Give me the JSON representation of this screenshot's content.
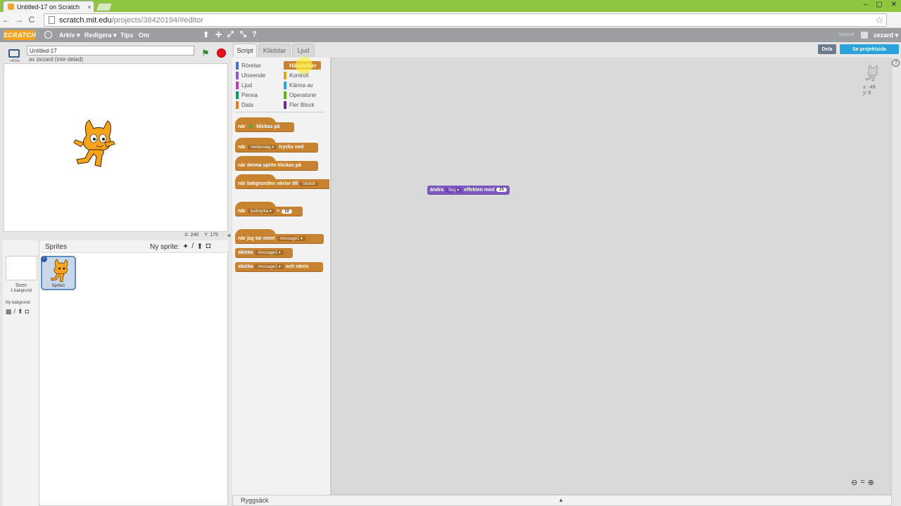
{
  "browser": {
    "tab_title": "Untitled-17 on Scratch",
    "tab_close": "×",
    "url_domain": "scratch.mit.edu",
    "url_path": "/projects/38420194/#editor",
    "window_controls": [
      "–",
      "▢",
      "✕"
    ],
    "nav": {
      "back": "←",
      "forward": "→",
      "reload": "C"
    },
    "star": "☆"
  },
  "menubar": {
    "logo": "SCRATCH",
    "items": [
      "Arkiv ▾",
      "Redigera ▾",
      "Tips",
      "Om"
    ],
    "tool_icons": [
      "⬆",
      "✛",
      "⤢",
      "⤡",
      "?"
    ],
    "saved": "Sparad",
    "user": "zezard ▾"
  },
  "stage": {
    "version": "v429a",
    "title_value": "Untitled-17",
    "byline": "av zezard (inte delad)",
    "coords_x": "X: 240",
    "coords_y": "Y: 175",
    "collapse": "◀",
    "green_flag": "⚑"
  },
  "tabs": [
    "Script",
    "Klädslar",
    "Ljud"
  ],
  "share_button": "Dela",
  "project_page_button": "Se projektsida",
  "categories": {
    "left": [
      {
        "label": "Rörelse",
        "color": "#4a6cd4"
      },
      {
        "label": "Utseende",
        "color": "#8a55d7"
      },
      {
        "label": "Ljud",
        "color": "#bb42c3"
      },
      {
        "label": "Penna",
        "color": "#0e9a6c"
      },
      {
        "label": "Data",
        "color": "#ee7d16"
      }
    ],
    "right": [
      {
        "label": "Händelser",
        "color": "#c88330"
      },
      {
        "label": "Kontroll",
        "color": "#e1a91a"
      },
      {
        "label": "Känna av",
        "color": "#2ca5e2"
      },
      {
        "label": "Operatorer",
        "color": "#5cb712"
      },
      {
        "label": "Fler Block",
        "color": "#632d99"
      }
    ]
  },
  "palette_blocks": {
    "b1_pre": "när",
    "b1_flag": "⚑",
    "b1_post": "klickas på",
    "b2_pre": "när",
    "b2_slot": "mellanslag ▾",
    "b2_post": "trycks ned",
    "b3": "när denna sprite klickas på",
    "b4_pre": "när bakgrunden växlar till",
    "b4_slot": "backdr",
    "b5_pre": "när",
    "b5_slot": "ljudstyrka ▾",
    "b5_op": ">",
    "b5_num": "10",
    "b6_pre": "när jag tar emot",
    "b6_slot": "message1 ▾",
    "b7_pre": "skicka",
    "b7_slot": "message1 ▾",
    "b8_pre": "skicka",
    "b8_slot": "message1 ▾",
    "b8_post": "och vänta"
  },
  "script_block": {
    "pre": "ändra",
    "slot": "färg ▾",
    "mid": "effekten med",
    "num": "25"
  },
  "sprite_coords": {
    "x": "x: -49",
    "y": "y: 8"
  },
  "help": "?",
  "zoom": [
    "⊖",
    "=",
    "⊕"
  ],
  "sprites_panel": {
    "scene_label": "Scen",
    "scene_sub": "1 bakgrund",
    "new_background": "Ny bakgrund:",
    "bg_icons": [
      "▩",
      "/",
      "⬆",
      "◘"
    ],
    "sprites_label": "Sprites",
    "new_sprite": "Ny sprite:",
    "sprite_icons": [
      "✦",
      "/",
      "⬆",
      "◘"
    ],
    "sprite_name": "Sprite1",
    "info": "i"
  },
  "backpack": {
    "label": "Ryggsäck",
    "arrow": "▲"
  }
}
